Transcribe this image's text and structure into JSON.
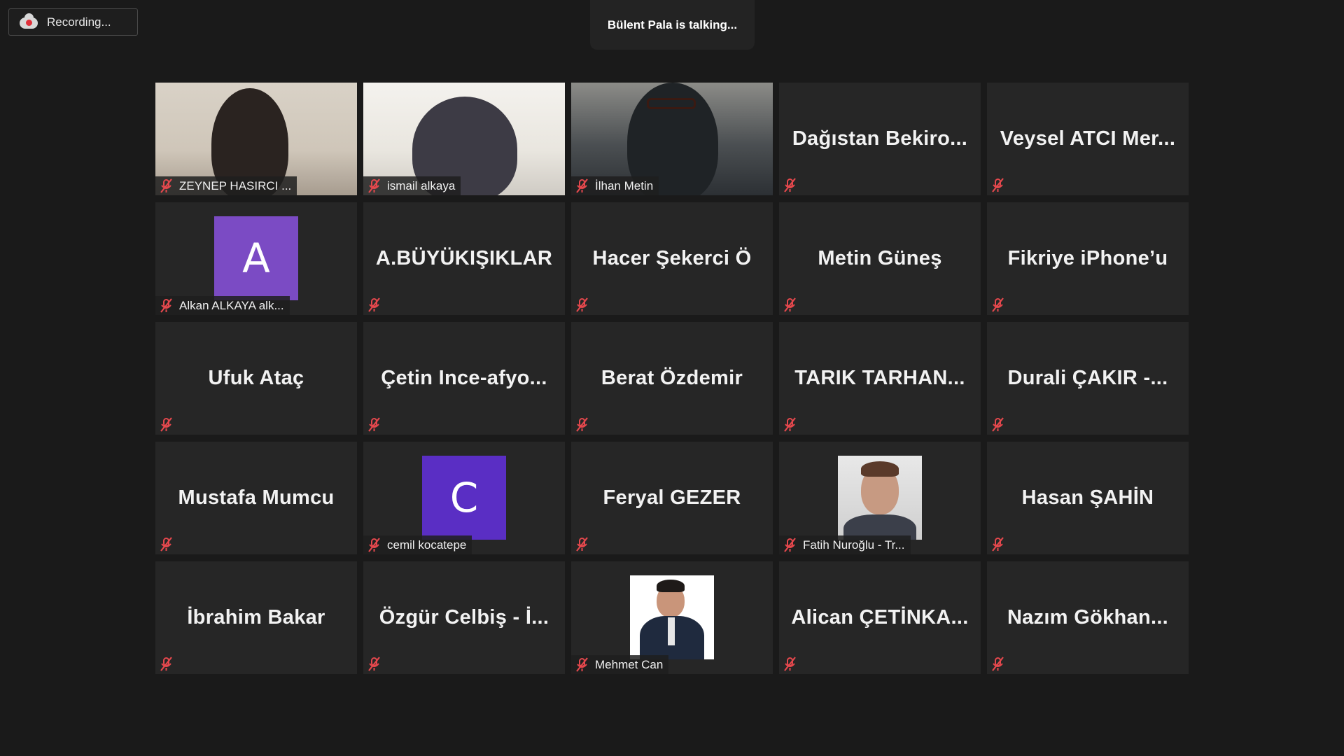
{
  "recording": {
    "label": "Recording..."
  },
  "talking": {
    "text": "Bülent Pala is talking..."
  },
  "tiles": [
    {
      "type": "video",
      "label": "ZEYNEP HASIRCI ..."
    },
    {
      "type": "video",
      "label": "ismail alkaya"
    },
    {
      "type": "video",
      "label": "İlhan Metin"
    },
    {
      "type": "name",
      "title": "Dağıstan  Bekiro..."
    },
    {
      "type": "name",
      "title": "Veysel  ATCI  Mer..."
    },
    {
      "type": "avatar",
      "letter": "A",
      "color": "#7b4bc4",
      "label": "Alkan ALKAYA alk..."
    },
    {
      "type": "name",
      "title": "A.BÜYÜKIŞIKLAR"
    },
    {
      "type": "name",
      "title": "Hacer Şekerci Ö"
    },
    {
      "type": "name",
      "title": "Metin Güneş"
    },
    {
      "type": "name",
      "title": "Fikriye iPhone’u"
    },
    {
      "type": "name",
      "title": "Ufuk Ataç"
    },
    {
      "type": "name",
      "title": "Çetin  Ince-afyo..."
    },
    {
      "type": "name",
      "title": "Berat Özdemir"
    },
    {
      "type": "name",
      "title": "TARIK  TARHAN..."
    },
    {
      "type": "name",
      "title": "Durali  ÇAKIR  -..."
    },
    {
      "type": "name",
      "title": "Mustafa Mumcu"
    },
    {
      "type": "avatar",
      "letter": "C",
      "color": "#5a2ec4",
      "label": "cemil kocatepe"
    },
    {
      "type": "name",
      "title": "Feryal GEZER"
    },
    {
      "type": "photo",
      "label": "Fatih Nuroğlu - Tr..."
    },
    {
      "type": "name",
      "title": "Hasan ŞAHİN"
    },
    {
      "type": "name",
      "title": "İbrahim Bakar"
    },
    {
      "type": "name",
      "title": "Özgür  Celbiş  -  İ..."
    },
    {
      "type": "photo",
      "label": "Mehmet Can"
    },
    {
      "type": "name",
      "title": "Alican  ÇETİNKA..."
    },
    {
      "type": "name",
      "title": "Nazım  Gökhan..."
    }
  ]
}
